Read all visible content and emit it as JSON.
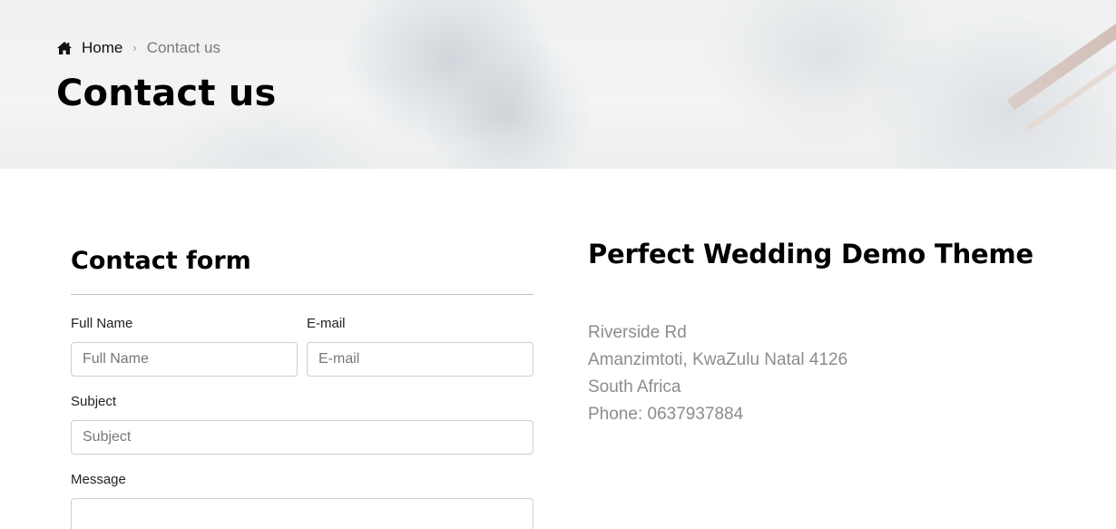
{
  "breadcrumb": {
    "home_label": "Home",
    "separator": "›",
    "current_label": "Contact us"
  },
  "page": {
    "title": "Contact us"
  },
  "form": {
    "title": "Contact form",
    "full_name": {
      "label": "Full Name",
      "placeholder": "Full Name",
      "value": ""
    },
    "email": {
      "label": "E-mail",
      "placeholder": "E-mail",
      "value": ""
    },
    "subject": {
      "label": "Subject",
      "placeholder": "Subject",
      "value": ""
    },
    "message": {
      "label": "Message",
      "placeholder": "",
      "value": ""
    }
  },
  "info": {
    "title": "Perfect Wedding Demo Theme",
    "address_line1": "Riverside Rd",
    "address_line2": "Amanzimtoti, KwaZulu Natal 4126",
    "country": "South Africa",
    "phone": "Phone: 0637937884"
  },
  "icons": {
    "home": "home-icon"
  }
}
